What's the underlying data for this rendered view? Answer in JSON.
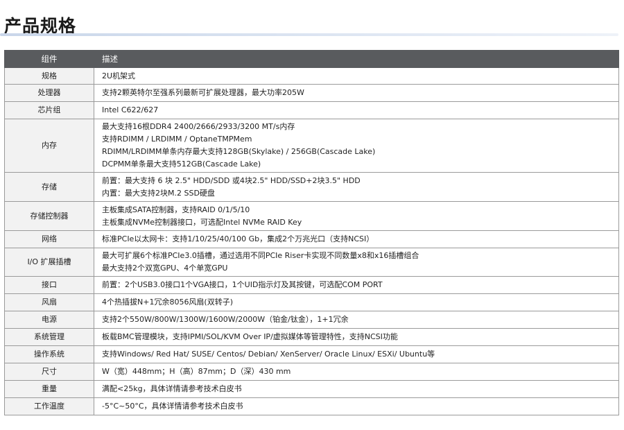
{
  "page": {
    "title": "产品规格"
  },
  "table": {
    "header": {
      "component": "组件",
      "description": "描述"
    },
    "rows": [
      {
        "label": "规格",
        "lines": [
          "2U机架式"
        ]
      },
      {
        "label": "处理器",
        "lines": [
          "支持2颗英特尔至强系列最新可扩展处理器，最大功率205W"
        ]
      },
      {
        "label": "芯片组",
        "lines": [
          "Intel C622/627"
        ]
      },
      {
        "label": "内存",
        "lines": [
          "最大支持16根DDR4 2400/2666/2933/3200 MT/s内存",
          "支持RDIMM / LRDIMM / OptaneTMPMem",
          "RDIMM/LRDIMM单条内存最大支持128GB(Skylake) / 256GB(Cascade Lake)",
          "DCPMM单条最大支持512GB(Cascade Lake)"
        ]
      },
      {
        "label": "存储",
        "lines": [
          "前置：最大支持 6 块 2.5\" HDD/SDD 或4块2.5\" HDD/SSD+2块3.5\" HDD",
          "内置：最大支持2块M.2 SSD硬盘"
        ]
      },
      {
        "label": "存储控制器",
        "lines": [
          "主板集成SATA控制器，支持RAID 0/1/5/10",
          "主板集成NVMe控制器接口，可选配Intel NVMe RAID Key"
        ]
      },
      {
        "label": "网络",
        "lines": [
          "标准PCIe以太网卡：支持1/10/25/40/100 Gb，集成2个万兆光口（支持NCSI）"
        ]
      },
      {
        "label": "I/O 扩展插槽",
        "lines": [
          "最大可扩展6个标准PCIe3.0插槽，通过选用不同PCIe Riser卡实现不同数量x8和x16插槽组合",
          "最大支持2个双宽GPU、4个单宽GPU"
        ]
      },
      {
        "label": "接口",
        "lines": [
          "前置：2个USB3.0接口1个VGA接口，1个UID指示灯及其按键，可选配COM PORT"
        ]
      },
      {
        "label": "风扇",
        "lines": [
          "4个热插拔N+1冗余8056风扇(双转子)"
        ]
      },
      {
        "label": "电源",
        "lines": [
          "支持2个550W/800W/1300W/1600W/2000W（铂金/钛金），1+1冗余"
        ]
      },
      {
        "label": "系统管理",
        "lines": [
          "板载BMC管理模块，支持IPMI/SOL/KVM Over IP/虚拟媒体等管理特性，支持NCSI功能"
        ]
      },
      {
        "label": "操作系统",
        "lines": [
          "支持Windows/ Red Hat/ SUSE/ Centos/ Debian/ XenServer/ Oracle Linux/ ESXi/ Ubuntu等"
        ]
      },
      {
        "label": "尺寸",
        "lines": [
          "W（宽）448mm；H（高）87mm；D（深）430 mm"
        ]
      },
      {
        "label": "重量",
        "lines": [
          "满配<25kg，具体详情请参考技术白皮书"
        ]
      },
      {
        "label": "工作温度",
        "lines": [
          "-5°C~50°C，具体详情请参考技术白皮书"
        ]
      }
    ]
  }
}
